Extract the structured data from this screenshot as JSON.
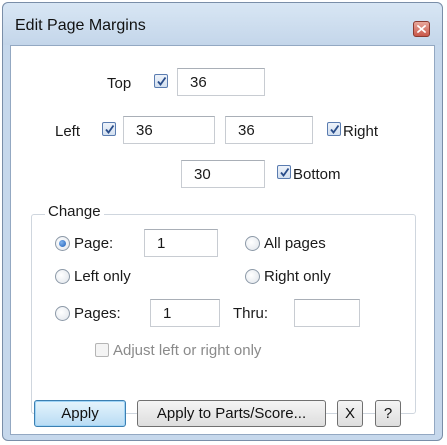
{
  "dialog": {
    "title": "Edit Page Margins"
  },
  "margins": {
    "top": {
      "label": "Top",
      "checked": true,
      "value": "36"
    },
    "left": {
      "label": "Left",
      "checked": true,
      "value": "36"
    },
    "right": {
      "label": "Right",
      "checked": true,
      "value": "36"
    },
    "bottom": {
      "label": "Bottom",
      "checked": true,
      "value": "30"
    }
  },
  "change": {
    "group_label": "Change",
    "page_label": "Page:",
    "page_value": "1",
    "all_pages_label": "All pages",
    "left_only_label": "Left only",
    "right_only_label": "Right only",
    "pages_label": "Pages:",
    "pages_from_value": "1",
    "thru_label": "Thru:",
    "thru_value": "",
    "selected": "Page",
    "adjust_label": "Adjust left or right only",
    "adjust_checked": false,
    "adjust_enabled": false
  },
  "buttons": {
    "apply": "Apply",
    "apply_parts": "Apply to Parts/Score...",
    "close": "X",
    "help": "?"
  },
  "icons": {
    "title_close": "close-icon",
    "checkmark": "checkmark-icon"
  }
}
